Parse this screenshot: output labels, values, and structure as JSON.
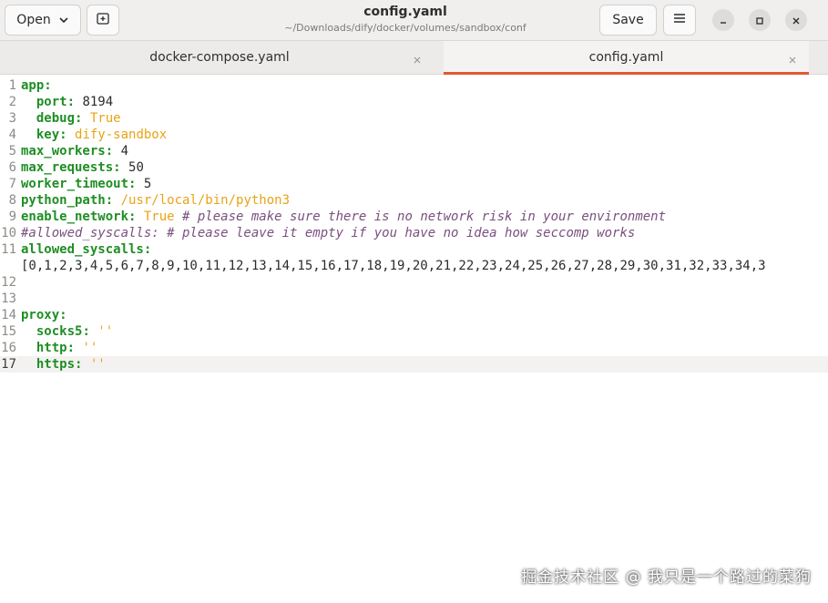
{
  "header": {
    "open_label": "Open",
    "save_label": "Save",
    "title": "config.yaml",
    "subtitle": "~/Downloads/dify/docker/volumes/sandbox/conf"
  },
  "tabs": [
    {
      "label": "docker-compose.yaml",
      "active": false
    },
    {
      "label": "config.yaml",
      "active": true
    }
  ],
  "editor": {
    "current_line": 17,
    "lines": [
      {
        "n": "1",
        "key": "app:",
        "sep": "",
        "value": "",
        "value_class": "",
        "comment": ""
      },
      {
        "n": "2",
        "key": "  port",
        "sep": ": ",
        "value": "8194",
        "value_class": "num",
        "comment": ""
      },
      {
        "n": "3",
        "key": "  debug",
        "sep": ": ",
        "value": "True",
        "value_class": "val",
        "comment": ""
      },
      {
        "n": "4",
        "key": "  key",
        "sep": ": ",
        "value": "dify-sandbox",
        "value_class": "val",
        "comment": ""
      },
      {
        "n": "5",
        "key": "max_workers",
        "sep": ": ",
        "value": "4",
        "value_class": "num",
        "comment": ""
      },
      {
        "n": "6",
        "key": "max_requests",
        "sep": ": ",
        "value": "50",
        "value_class": "num",
        "comment": ""
      },
      {
        "n": "7",
        "key": "worker_timeout",
        "sep": ": ",
        "value": "5",
        "value_class": "num",
        "comment": ""
      },
      {
        "n": "8",
        "key": "python_path",
        "sep": ": ",
        "value": "/usr/local/bin/python3",
        "value_class": "val",
        "comment": ""
      },
      {
        "n": "9",
        "key": "enable_network",
        "sep": ": ",
        "value": "True",
        "value_class": "val",
        "comment": " # please make sure there is no network risk in your environment"
      },
      {
        "n": "10",
        "key": "",
        "sep": "",
        "value": "",
        "value_class": "",
        "comment": "#allowed_syscalls: # please leave it empty if you have no idea how seccomp works"
      },
      {
        "n": "11",
        "key": "allowed_syscalls:",
        "sep": "",
        "value": "",
        "value_class": "",
        "comment": ""
      },
      {
        "n": "",
        "key": "",
        "sep": "",
        "value": "[0,1,2,3,4,5,6,7,8,9,10,11,12,13,14,15,16,17,18,19,20,21,22,23,24,25,26,27,28,29,30,31,32,33,34,3",
        "value_class": "plain",
        "comment": ""
      },
      {
        "n": "12",
        "key": "",
        "sep": "",
        "value": "",
        "value_class": "",
        "comment": ""
      },
      {
        "n": "13",
        "key": "",
        "sep": "",
        "value": "",
        "value_class": "",
        "comment": ""
      },
      {
        "n": "14",
        "key": "proxy:",
        "sep": "",
        "value": "",
        "value_class": "",
        "comment": ""
      },
      {
        "n": "15",
        "key": "  socks5",
        "sep": ": ",
        "value": "''",
        "value_class": "str",
        "comment": ""
      },
      {
        "n": "16",
        "key": "  http",
        "sep": ": ",
        "value": "''",
        "value_class": "str",
        "comment": ""
      },
      {
        "n": "17",
        "key": "  https",
        "sep": ": ",
        "value": "''",
        "value_class": "str",
        "comment": ""
      }
    ]
  },
  "watermark": "掘金技术社区 @ 我只是一个路过的菜狗"
}
